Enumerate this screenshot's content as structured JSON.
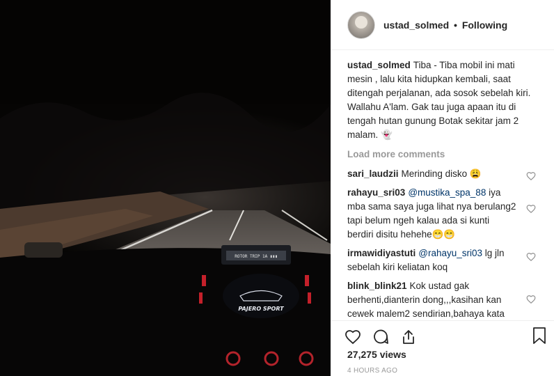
{
  "post": {
    "username": "ustad_solmed",
    "separator": "•",
    "follow_status": "Following"
  },
  "caption": {
    "username": "ustad_solmed",
    "text": "Tiba - Tiba mobil ini mati mesin , lalu kita hidupkan kembali, saat ditengah perjalanan, ada sosok sebelah kiri. Wallahu A'lam. Gak tau juga apaan itu di tengah hutan gunung Botak sekitar jam 2 malam. 👻"
  },
  "load_more": "Load more comments",
  "comments": [
    {
      "username": "sari_laudzii",
      "text": "Merinding disko 😩"
    },
    {
      "username": "rahayu_sri03",
      "mention": "@mustika_spa_88",
      "text": " iya mba sama saya juga lihat nya berulang2 tapi belum ngeh kalau ada si kunti berdiri disitu hehehe😁😁"
    },
    {
      "username": "irmawidiyastuti",
      "mention": "@rahayu_sri03",
      "text": " lg jln sebelah kiri keliatan koq"
    },
    {
      "username": "blink_blink21",
      "text": "Kok ustad gak berhenti,dianterin dong,,,kasihan kan cewek malem2 sendirian,bahaya kata mama saya🙏"
    }
  ],
  "views": "27,275 views",
  "timestamp": "4 HOURS AGO",
  "dashboard": {
    "display_text": "PAJERO SPORT"
  }
}
